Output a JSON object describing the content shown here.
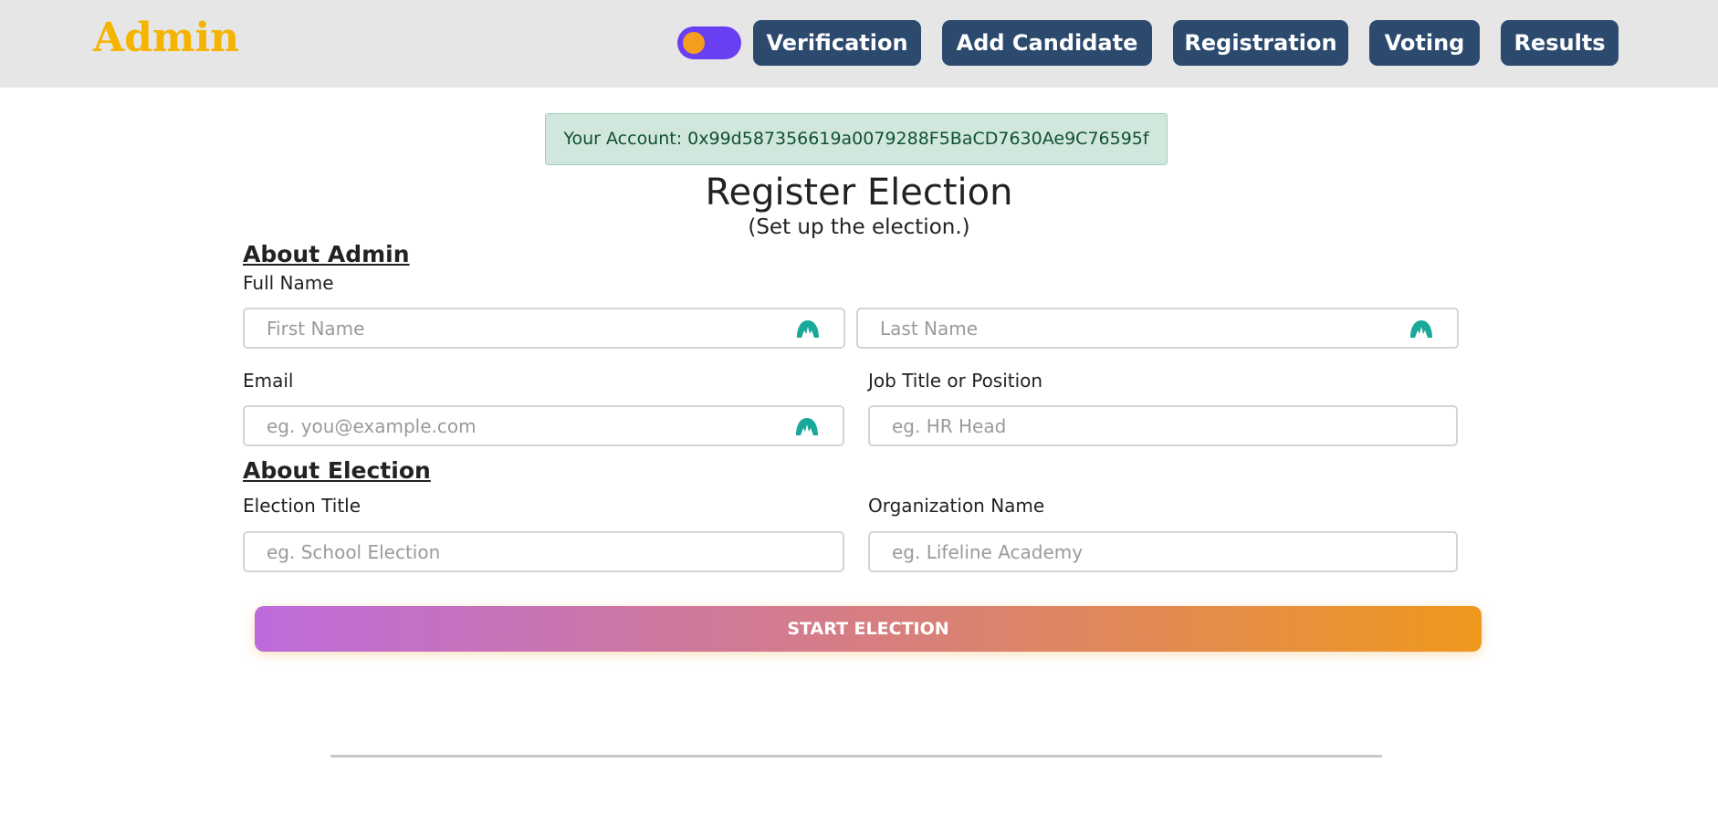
{
  "navbar": {
    "brand": "Admin",
    "theme_toggle": {
      "state": "on"
    },
    "buttons": [
      "Verification",
      "Add Candidate",
      "Registration",
      "Voting",
      "Results"
    ]
  },
  "account_banner": "Your Account: 0x99d587356619a0079288F5BaCD7630Ae9C76595f",
  "page": {
    "title": "Register Election",
    "subtitle": "(Set up the election.)"
  },
  "about_admin": {
    "heading": "About Admin",
    "full_name_label": "Full Name",
    "first_name_placeholder": "First Name",
    "last_name_placeholder": "Last Name",
    "email_label": "Email",
    "email_placeholder": "eg. you@example.com",
    "job_label": "Job Title or Position",
    "job_placeholder": "eg. HR Head"
  },
  "about_election": {
    "heading": "About Election",
    "title_label": "Election Title",
    "title_placeholder": "eg. School Election",
    "org_label": "Organization Name",
    "org_placeholder": "eg. Lifeline Academy"
  },
  "start_button": "START ELECTION",
  "colors": {
    "brand": "#f4b400",
    "nav_button": "#2c4a6e",
    "toggle_track": "#6a3ff2",
    "toggle_knob": "#f59d1c",
    "account_bg": "#d1e7dd",
    "account_text": "#0f5132",
    "autofill_icon": "#1aa89a",
    "gradient_start": "#bd6bdc",
    "gradient_end": "#ef981d"
  },
  "icons": {
    "autofill": "autofill-extension-icon"
  }
}
